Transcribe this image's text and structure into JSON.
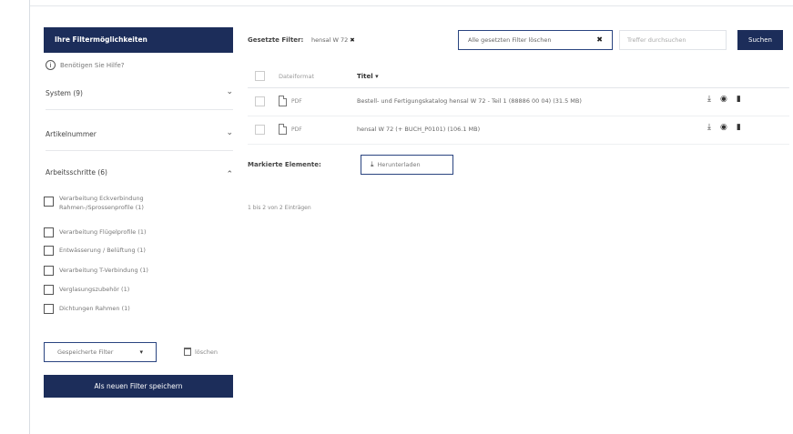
{
  "sidebar": {
    "header": "Ihre Filtermöglichkeiten",
    "help": {
      "icon": "info-circle-icon",
      "label": "Benötigen Sie Hilfe?"
    },
    "sections": [
      {
        "label": "System (9)",
        "expanded": false
      },
      {
        "label": "Artikelnummer",
        "expanded": false
      },
      {
        "label": "Arbeitsschritte (6)",
        "expanded": true
      }
    ],
    "work_steps": [
      "Verarbeitung Eckverbindung Rahmen-/Sprossenprofile (1)",
      "Verarbeitung Flügelprofile (1)",
      "Entwässerung / Belüftung (1)",
      "Verarbeitung T-Verbindung (1)",
      "Verglasungszubehör (1)",
      "Dichtungen Rahmen (1)"
    ],
    "saved_filter_select": "Gespeicherte Filter",
    "delete_label": "löschen",
    "save_button": "Als neuen Filter speichern"
  },
  "filters": {
    "label": "Gesetzte Filter:",
    "active_chip": "hensal W 72",
    "clear_all": "Alle gesetzten Filter löschen",
    "search_placeholder": "Treffer durchsuchen",
    "search_button": "Suchen"
  },
  "table": {
    "columns": {
      "format": "Dateiformat",
      "title": "Titel"
    },
    "rows": [
      {
        "format": "PDF",
        "title": "Bestell- und Fertigungskatalog hensal W 72 - Teil 1 (88886 00 04) (31.5 MB)"
      },
      {
        "format": "PDF",
        "title": "hensal W 72 (+ BUCH_P0101) (106.1 MB)"
      }
    ]
  },
  "marked": {
    "label": "Markierte Elemente:",
    "download_button": "Herunterladen"
  },
  "pagination": {
    "summary": "1 bis 2 von 2 Einträgen"
  },
  "colors": {
    "brand": "#1c2d5a",
    "border": "#2a4480"
  }
}
